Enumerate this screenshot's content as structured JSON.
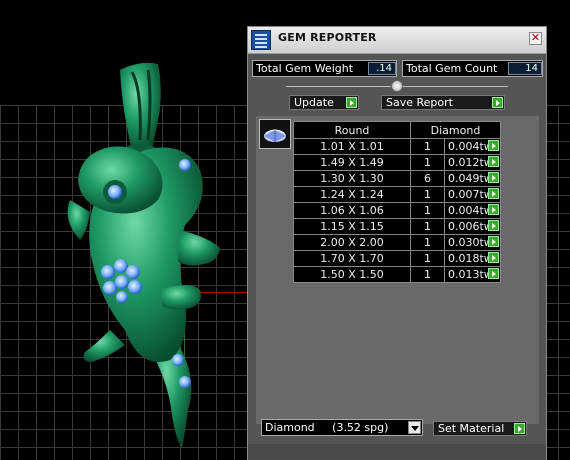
{
  "panel": {
    "title": "GEM REPORTER",
    "close_label": "✕"
  },
  "stats": {
    "total_weight_label": "Total Gem Weight",
    "total_weight_value": ".14",
    "total_count_label": "Total Gem Count",
    "total_count_value": "14"
  },
  "actions": {
    "update_label": "Update",
    "save_report_label": "Save Report",
    "set_material_label": "Set Material"
  },
  "table": {
    "headers": [
      "Round",
      "Diamond"
    ],
    "rows": [
      {
        "size": "1.01 X 1.01",
        "count": "1",
        "weight": "0.004tw"
      },
      {
        "size": "1.49 X 1.49",
        "count": "1",
        "weight": "0.012tw"
      },
      {
        "size": "1.30 X 1.30",
        "count": "6",
        "weight": "0.049tw"
      },
      {
        "size": "1.24 X 1.24",
        "count": "1",
        "weight": "0.007tw"
      },
      {
        "size": "1.06 X 1.06",
        "count": "1",
        "weight": "0.004tw"
      },
      {
        "size": "1.15 X 1.15",
        "count": "1",
        "weight": "0.006tw"
      },
      {
        "size": "2.00 X 2.00",
        "count": "1",
        "weight": "0.030tw"
      },
      {
        "size": "1.70 X 1.70",
        "count": "1",
        "weight": "0.018tw"
      },
      {
        "size": "1.50 X 1.50",
        "count": "1",
        "weight": "0.013tw"
      }
    ]
  },
  "material": {
    "selected": "Diamond     (3.52 spg)"
  },
  "colors": {
    "model": "#1b8a5e",
    "gem": "#7ab0ff",
    "arrow_button": "#3aa82e"
  }
}
